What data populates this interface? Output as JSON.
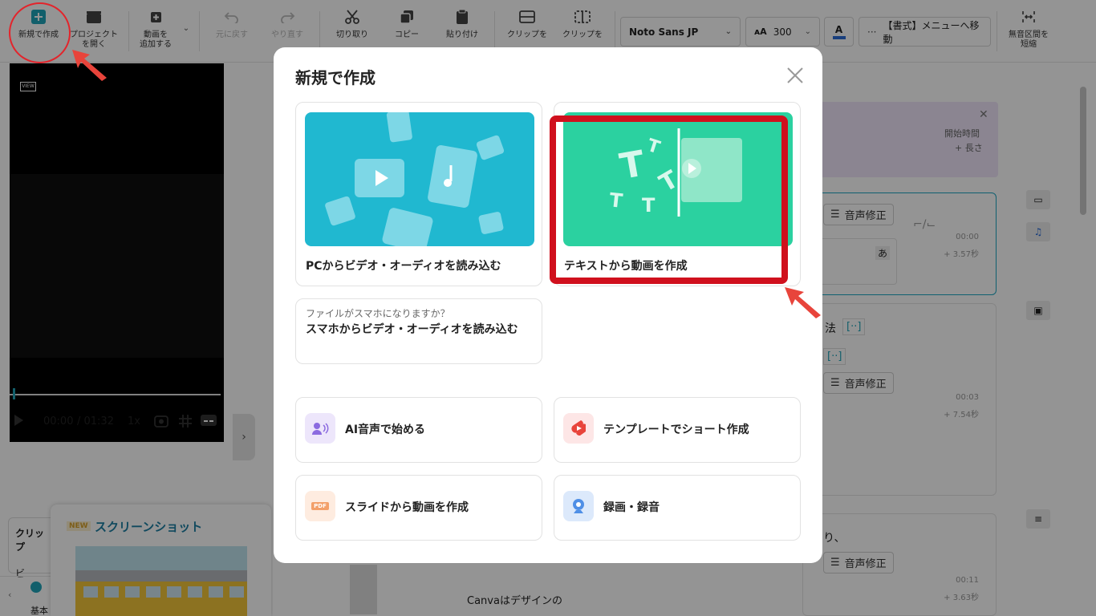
{
  "toolbar": {
    "new_create": "新規で作成",
    "open_project_1": "プロジェクト",
    "open_project_2": "を開く",
    "add_video_1": "動画を",
    "add_video_2": "追加する",
    "undo": "元に戻す",
    "redo": "やり直す",
    "cut": "切り取り",
    "copy": "コピー",
    "paste": "貼り付け",
    "clip_a": "クリップを",
    "clip_b": "クリップを",
    "font_name": "Noto Sans JP",
    "font_size": "300",
    "format_menu": "【書式】メニューへ移動",
    "shorten_silence_1": "無音区間を",
    "shorten_silence_2": "短縮"
  },
  "player": {
    "logo": "VIEW",
    "current_time": "00:00",
    "total_time": "/ 01:32",
    "speed": "1x"
  },
  "left": {
    "clip_label": "クリップ",
    "clip_item": "ビ",
    "bottom_tab": "基本"
  },
  "promo": {
    "badge": "NEW",
    "title": "スクリーンショット"
  },
  "right": {
    "start_time": "開始時間",
    "length": "+ 長さ",
    "audio_fix": "音声修正",
    "a_label": "あ",
    "method_frag": "法",
    "bracket": "[··]",
    "ri_frag": "り、",
    "canva_text": "Canvaはデザインの",
    "rows": [
      {
        "time": "00:00",
        "dur": "+ 3.57秒"
      },
      {
        "time": "00:03",
        "dur": "+ 7.54秒"
      },
      {
        "time": "00:11",
        "dur": "+ 3.63秒"
      }
    ]
  },
  "modal": {
    "title": "新規で作成",
    "opt_pc": "PCからビデオ・オーディオを読み込む",
    "opt_text": "テキストから動画を作成",
    "phone_sub": "ファイルがスマホになりますか？",
    "phone_main": "スマホからビデオ・オーディオを読み込む",
    "ai_voice": "AI音声で始める",
    "template_short": "テンプレートでショート作成",
    "slide_video": "スライドから動画を作成",
    "record": "録画・録音",
    "pdf_tag": "PDF"
  },
  "colors": {
    "accent": "#20a4b8",
    "pc_card_bg": "#20b8d0",
    "text_card_bg": "#2bd1a0",
    "annotation_red": "#d0101d"
  }
}
